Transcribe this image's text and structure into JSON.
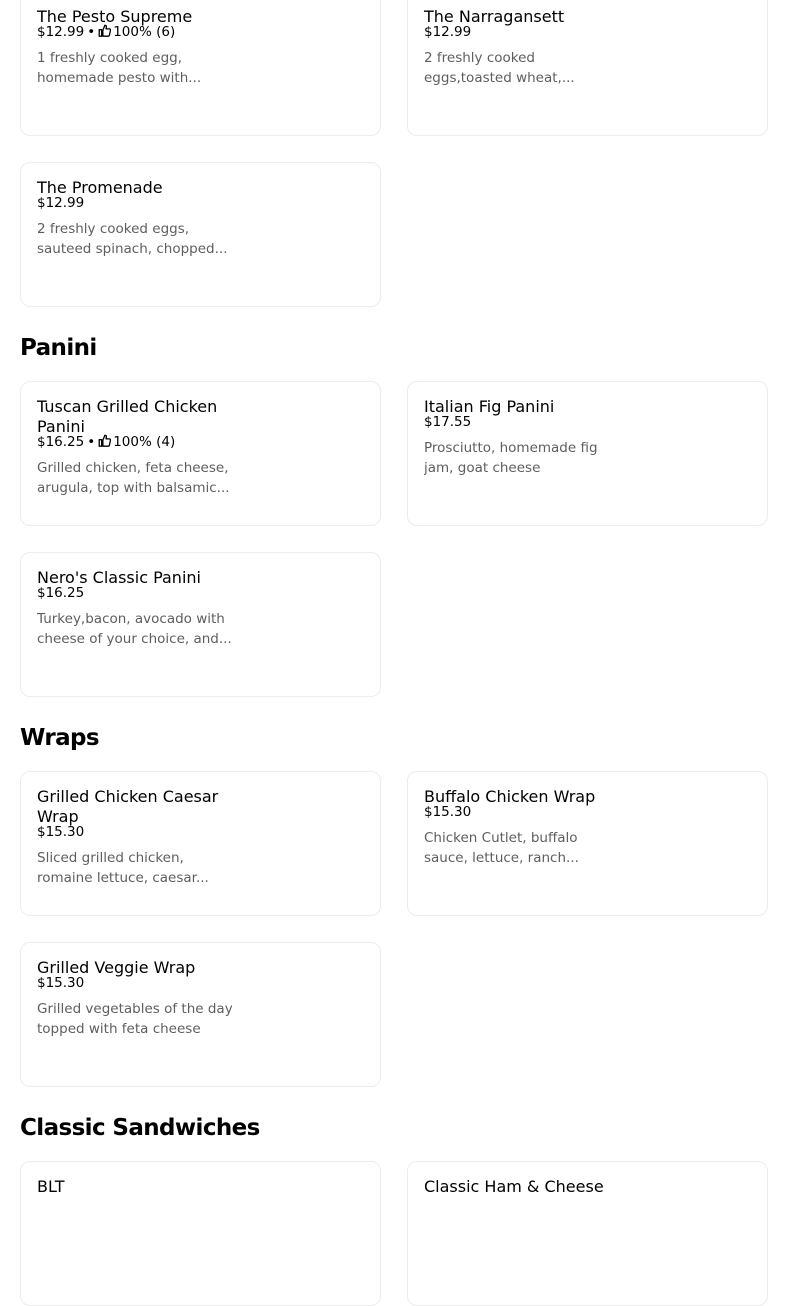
{
  "sections": [
    {
      "title": "Panini"
    },
    {
      "title": "Wraps"
    },
    {
      "title": "Classic Sandwiches"
    }
  ],
  "items": {
    "pesto": {
      "title": "The Pesto Supreme",
      "price": "$12.99",
      "rating": "100% (6)",
      "desc1": "1 freshly cooked egg,",
      "desc2": "homemade pesto with..."
    },
    "narragansett": {
      "title": "The Narragansett",
      "price": "$12.99",
      "desc1": "2 freshly cooked",
      "desc2": "eggs,toasted wheat,..."
    },
    "promenade": {
      "title": "The Promenade",
      "price": "$12.99",
      "desc1": "2 freshly cooked eggs,",
      "desc2": "sauteed spinach, chopped..."
    },
    "tuscan": {
      "title1": "Tuscan Grilled Chicken",
      "title2": "Panini",
      "price": "$16.25",
      "rating": "100% (4)",
      "desc1": "Grilled chicken, feta cheese,",
      "desc2": "arugula, top with balsamic..."
    },
    "fig": {
      "title": "Italian Fig Panini",
      "price": "$17.55",
      "desc1": "Prosciutto, homemade fig",
      "desc2": "jam, goat cheese"
    },
    "nero": {
      "title": "Nero's Classic Panini",
      "price": "$16.25",
      "desc1": "Turkey,bacon, avocado with",
      "desc2": "cheese of your choice, and..."
    },
    "caesar": {
      "title1": "Grilled Chicken Caesar",
      "title2": "Wrap",
      "price": "$15.30",
      "desc1": "Sliced grilled chicken,",
      "desc2": "romaine lettuce, caesar..."
    },
    "buffalo": {
      "title": "Buffalo Chicken Wrap",
      "price": "$15.30",
      "desc1": "Chicken Cutlet, buffalo",
      "desc2": "sauce, lettuce, ranch..."
    },
    "veggie": {
      "title": "Grilled Veggie Wrap",
      "price": "$15.30",
      "desc1": "Grilled vegetables of the day",
      "desc2": "topped with feta cheese"
    },
    "blt": {
      "title": "BLT"
    },
    "ham": {
      "title": "Classic Ham & Cheese"
    }
  },
  "separator": "•",
  "icons": {
    "rating": "thumbs-up-icon"
  },
  "colors": {
    "text": "#000000",
    "muted": "#5e5e5e",
    "border": "#ececec"
  }
}
